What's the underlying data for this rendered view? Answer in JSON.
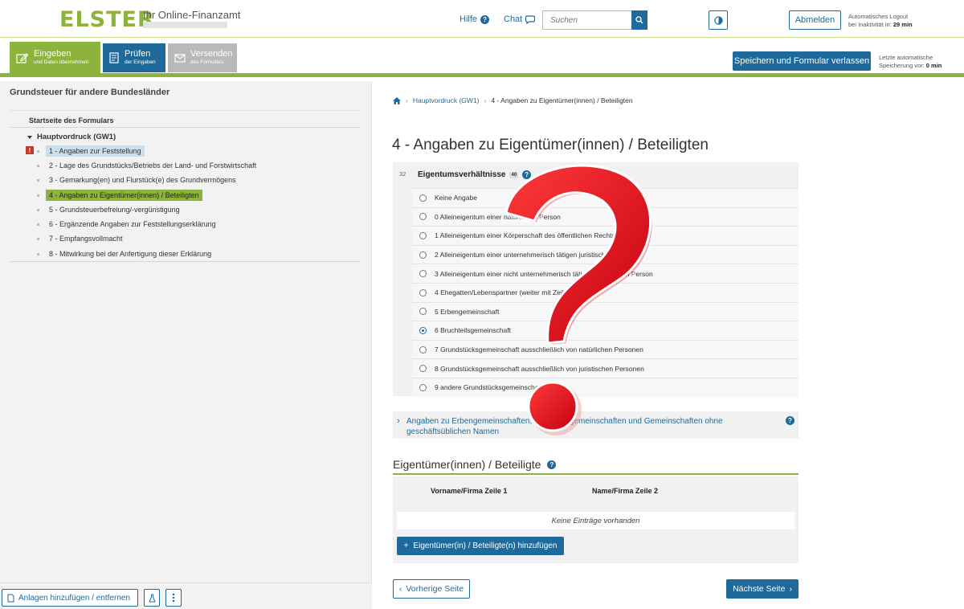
{
  "header": {
    "logo": "ELSTER",
    "logo_sub": "Ihr Online-Finanzamt",
    "help": "Hilfe",
    "chat": "Chat",
    "search_placeholder": "Suchen",
    "logout_button": "Abmelden",
    "logout_info_line1": "Automatisches Logout",
    "logout_info_line2": "bei Inaktivität in:",
    "logout_time": "29 min"
  },
  "steps": [
    {
      "main": "Eingeben",
      "sub": "und Daten übernehmen",
      "state": "active",
      "color": "#8cb33b"
    },
    {
      "main": "Prüfen",
      "sub": "der Eingaben",
      "state": "available",
      "color": "#1f6a9a"
    },
    {
      "main": "Versenden",
      "sub": "des Formulars",
      "state": "disabled",
      "color": "#b9b9b9"
    }
  ],
  "toolbar": {
    "save_leave": "Speichern und Formular verlassen",
    "last_save_line1": "Letzte automatische",
    "last_save_line2": "Speicherung vor:",
    "last_save_time": "0 min"
  },
  "sidebar": {
    "title": "Grundsteuer für andere Bundesländer",
    "start": "Startseite des Formulars",
    "group": "Hauptvordruck (GW1)",
    "error_marker": "!",
    "items": [
      {
        "label": "1 - Angaben zur Feststellung",
        "state": "error"
      },
      {
        "label": "2 - Lage des Grundstücks/Betriebs der Land- und Forstwirtschaft",
        "state": "normal"
      },
      {
        "label": "3 - Gemarkung(en) und Flurstück(e) des Grundvermögens",
        "state": "normal"
      },
      {
        "label": "4 - Angaben zu Eigentümer(innen) / Beteiligten",
        "state": "current"
      },
      {
        "label": "5 - Grundsteuerbefreiung/-vergünstigung",
        "state": "normal"
      },
      {
        "label": "6 - Ergänzende Angaben zur Feststellungserklärung",
        "state": "normal"
      },
      {
        "label": "7 - Empfangsvollmacht",
        "state": "normal"
      },
      {
        "label": "8 - Mitwirkung bei der Anfertigung dieser Erklärung",
        "state": "normal"
      }
    ],
    "attach_button": "Anlagen hinzufügen / entfernen"
  },
  "breadcrumb": {
    "link": "Hauptvordruck (GW1)",
    "current": "4 - Angaben zu Eigentümer(innen) / Beteiligten"
  },
  "page_title": "4 - Angaben zu Eigentümer(innen) / Beteiligten",
  "ownership": {
    "line_number": "32",
    "label": "Eigentumsverhältnisse",
    "field_code": "40",
    "selected_index": 7,
    "options": [
      "Keine Angabe",
      "0 Alleineigentum einer natürlichen Person",
      "1 Alleineigentum einer Körperschaft des öffentlichen Rechts",
      "2 Alleineigentum einer unternehmerisch tätigen juristischen Person",
      "3 Alleineigentum einer nicht unternehmerisch tätigen juristischen Person",
      "4 Ehegatten/Lebenspartner (weiter mit Zeile 41)",
      "5 Erbengemeinschaft",
      "6 Bruchteilsgemeinschaft",
      "7 Grundstücksgemeinschaft ausschließlich von natürlichen Personen",
      "8 Grundstücksgemeinschaft ausschließlich von juristischen Personen",
      "9 andere Grundstücksgemeinschaften"
    ]
  },
  "accordion": {
    "text": "Angaben zu Erbengemeinschaften, Bruchteilsgemeinschaften und Gemeinschaften ohne geschäftsüblichen Namen"
  },
  "owners": {
    "title": "Eigentümer(innen) / Beteiligte",
    "col1": "Vorname/Firma Zeile 1",
    "col2": "Name/Firma Zeile 2",
    "empty": "Keine Einträge vorhanden",
    "add_button": "Eigentümer(in) / Beteiligte(n) hinzufügen"
  },
  "nav": {
    "prev": "Vorherige Seite",
    "next": "Nächste Seite"
  },
  "colors": {
    "brand_green": "#8cb33b",
    "brand_blue": "#1f6a9a",
    "overlay_red": "#e0141c"
  }
}
